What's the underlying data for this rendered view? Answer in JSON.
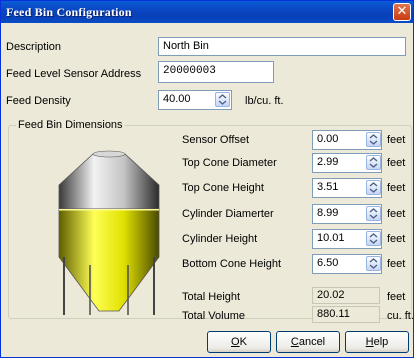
{
  "window": {
    "title": "Feed Bin Configuration",
    "close_glyph": "✕"
  },
  "form": {
    "description_label": "Description",
    "description_value": "North Bin",
    "sensor_address_label": "Feed Level Sensor Address",
    "sensor_address_value": "20000003",
    "density_label": "Feed Density",
    "density_value": "40.00",
    "density_unit": "lb/cu. ft."
  },
  "dimensions": {
    "group_label": "Feed Bin Dimensions",
    "unit": "feet",
    "fields": [
      {
        "label": "Sensor Offset",
        "value": "0.00"
      },
      {
        "label": "Top Cone Diameter",
        "value": "2.99"
      },
      {
        "label": "Top Cone Height",
        "value": "3.51"
      },
      {
        "label": "Cylinder Diamerter",
        "value": "8.99"
      },
      {
        "label": "Cylinder Height",
        "value": "10.01"
      },
      {
        "label": "Bottom Cone Height",
        "value": "6.50"
      }
    ],
    "total_height_label": "Total Height",
    "total_height_value": "20.02",
    "total_height_unit": "feet",
    "total_volume_label": "Total Volume",
    "total_volume_value": "880.11",
    "total_volume_unit": "cu. ft."
  },
  "buttons": {
    "ok": {
      "accel": "O",
      "rest": "K"
    },
    "cancel": {
      "accel": "C",
      "rest": "ancel"
    },
    "help": {
      "accel": "H",
      "rest": "elp"
    }
  },
  "colors": {
    "title_bar": "#0a4cc7",
    "feed_fill": "#e6e600",
    "bin_metal": "#b0b0b0"
  },
  "icons": [
    "close-icon",
    "spin-up-down-icon",
    "feed-bin-illustration"
  ]
}
